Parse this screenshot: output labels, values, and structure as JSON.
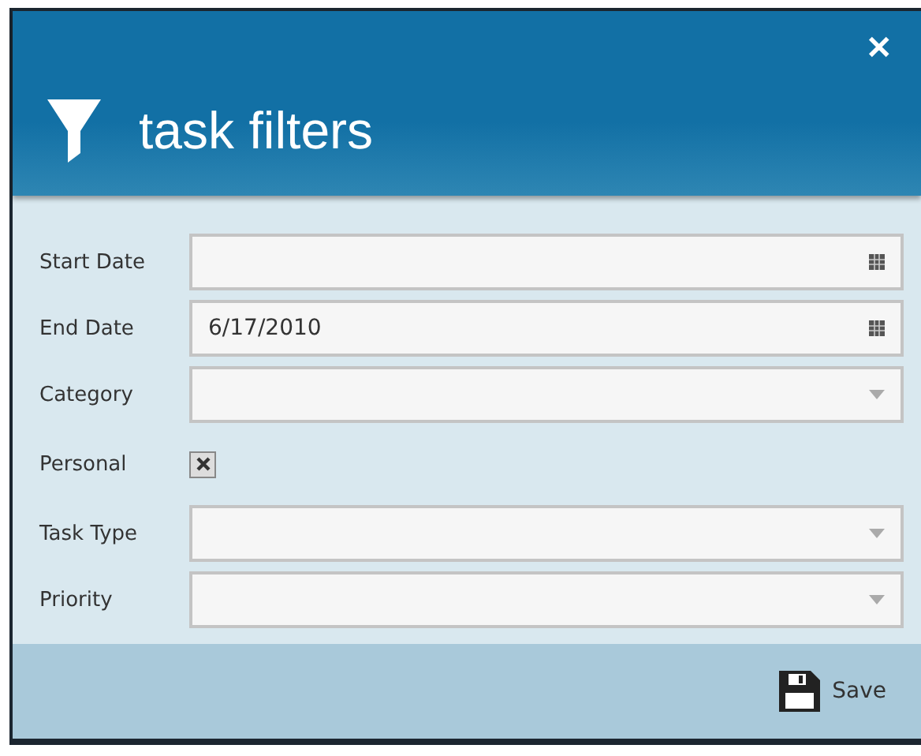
{
  "dialog": {
    "title": "task filters",
    "close": "✕"
  },
  "fields": [
    {
      "label": "Start Date",
      "kind": "date"
    },
    {
      "label": "End Date",
      "kind": "date",
      "value": "6/17/2010"
    },
    {
      "label": "Category",
      "kind": "combo"
    },
    {
      "label": "Personal",
      "kind": "checkbox",
      "checked": true
    },
    {
      "label": "Task Type",
      "kind": "combo"
    },
    {
      "label": "Priority",
      "kind": "combo"
    }
  ],
  "footer": {
    "save": "Save"
  }
}
